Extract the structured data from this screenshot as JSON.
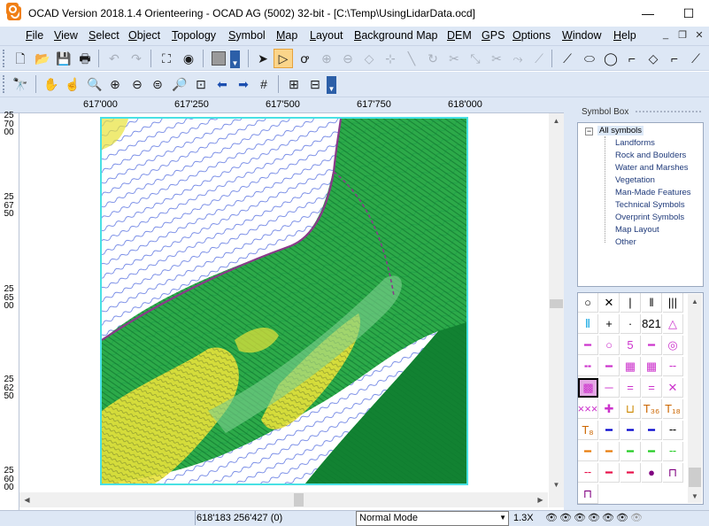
{
  "window": {
    "title": "OCAD Version 2018.1.4  Orienteering - OCAD AG (5002) 32-bit - [C:\\Temp\\UsingLidarData.ocd]",
    "minimize": "—",
    "maximize": "☐",
    "close": "✕"
  },
  "menu": {
    "items": [
      "File",
      "View",
      "Select",
      "Object",
      "Topology",
      "Symbol",
      "Map",
      "Layout",
      "Background Map",
      "DEM",
      "GPS",
      "Options",
      "Window",
      "Help"
    ],
    "mdi_minimize": "_",
    "mdi_restore": "❐",
    "mdi_close": "✕"
  },
  "toolbar1": {
    "icons": [
      "new-icon",
      "open-icon",
      "save-icon",
      "print-icon",
      "undo-icon",
      "redo-icon",
      "fullscreen-icon",
      "preview-icon",
      "fill-icon",
      "edit-object-icon",
      "edit-point-icon",
      "cut-hole-icon",
      "add-vertex-icon",
      "remove-vertex-icon",
      "corner-point-icon",
      "dash-point-icon",
      "reshape-icon",
      "rotate-icon",
      "cut-icon",
      "measure-icon",
      "stretch-icon",
      "smooth-icon",
      "curve-mode-icon",
      "ellipse-mode-icon",
      "circle-mode-icon",
      "rectangle-mode-icon",
      "straight-line-icon",
      "freehand-icon",
      "number-icon"
    ]
  },
  "toolbar2": {
    "icons": [
      "find-icon",
      "hand-icon",
      "move-icon",
      "zoom-in-icon",
      "zoom-out-icon",
      "zoom-prev-icon",
      "zoom-entire-icon",
      "zoom-window-icon",
      "back-icon",
      "forward-icon",
      "grid-icon",
      "layout-icon",
      "table-icon"
    ]
  },
  "ruler": {
    "top_labels": [
      "617'000",
      "617'250",
      "617'500",
      "617'750",
      "618'000"
    ],
    "left_labels": [
      "257000",
      "256750",
      "256500",
      "256250",
      "256000"
    ]
  },
  "symbol_box": {
    "title": "Symbol Box",
    "tree_root": "All symbols",
    "categories": [
      "Landforms",
      "Rock and Boulders",
      "Water and Marshes",
      "Vegetation",
      "Man-Made Features",
      "Technical Symbols",
      "Overprint Symbols",
      "Map Layout",
      "Other"
    ]
  },
  "symbols_grid": [
    {
      "glyph": "○",
      "color": "#000000"
    },
    {
      "glyph": "✕",
      "color": "#000000"
    },
    {
      "glyph": "|",
      "color": "#000000"
    },
    {
      "glyph": "‖",
      "color": "#000000"
    },
    {
      "glyph": "|||",
      "color": "#000000"
    },
    {
      "glyph": "⦀",
      "color": "#00a0e0"
    },
    {
      "glyph": "+",
      "color": "#000000"
    },
    {
      "glyph": "·",
      "color": "#000000"
    },
    {
      "glyph": "821",
      "color": "#000000"
    },
    {
      "glyph": "△",
      "color": "#cc33cc"
    },
    {
      "glyph": "━",
      "color": "#cc33cc"
    },
    {
      "glyph": "○",
      "color": "#cc33cc"
    },
    {
      "glyph": "5",
      "color": "#cc33cc"
    },
    {
      "glyph": "━",
      "color": "#cc33cc"
    },
    {
      "glyph": "◎",
      "color": "#cc33cc"
    },
    {
      "glyph": "╍",
      "color": "#cc33cc"
    },
    {
      "glyph": "━",
      "color": "#cc33cc"
    },
    {
      "glyph": "▦",
      "color": "#cc33cc"
    },
    {
      "glyph": "▦",
      "color": "#cc33cc"
    },
    {
      "glyph": "╌",
      "color": "#cc33cc"
    },
    {
      "glyph": "▩",
      "color": "#cc33cc"
    },
    {
      "glyph": "─",
      "color": "#cc33cc"
    },
    {
      "glyph": "=",
      "color": "#cc33cc"
    },
    {
      "glyph": "=",
      "color": "#cc33cc"
    },
    {
      "glyph": "✕",
      "color": "#cc33cc"
    },
    {
      "glyph": "×××",
      "color": "#cc33cc"
    },
    {
      "glyph": "✚",
      "color": "#cc33cc"
    },
    {
      "glyph": "⊔",
      "color": "#cc8800"
    },
    {
      "glyph": "T₃₆",
      "color": "#cc6600"
    },
    {
      "glyph": "T₁₈",
      "color": "#cc6600"
    },
    {
      "glyph": "T₈",
      "color": "#cc6600"
    },
    {
      "glyph": "━",
      "color": "#0000cc"
    },
    {
      "glyph": "━",
      "color": "#0000cc"
    },
    {
      "glyph": "━",
      "color": "#0000cc"
    },
    {
      "glyph": "╌",
      "color": "#000000"
    },
    {
      "glyph": "━",
      "color": "#e87b0a"
    },
    {
      "glyph": "━",
      "color": "#e87b0a"
    },
    {
      "glyph": "━",
      "color": "#22cc22"
    },
    {
      "glyph": "━",
      "color": "#22cc22"
    },
    {
      "glyph": "╌",
      "color": "#22cc22"
    },
    {
      "glyph": "╌",
      "color": "#e8104a"
    },
    {
      "glyph": "━",
      "color": "#e8104a"
    },
    {
      "glyph": "━",
      "color": "#e8104a"
    },
    {
      "glyph": "●",
      "color": "#800080"
    },
    {
      "glyph": "⊓",
      "color": "#800080"
    },
    {
      "glyph": "⊓",
      "color": "#800080"
    }
  ],
  "status": {
    "coords": "618'183   256'427    (0)",
    "mode": "Normal Mode",
    "zoom": "1.3X"
  },
  "colors": {
    "chrome": "#dde7f5",
    "map_frame": "#49e1e4",
    "selected_tool": "#fbd58a",
    "forest_green": "#1aa33a",
    "yellow_open": "#e8e23a",
    "contour": "#2a4ad8"
  }
}
